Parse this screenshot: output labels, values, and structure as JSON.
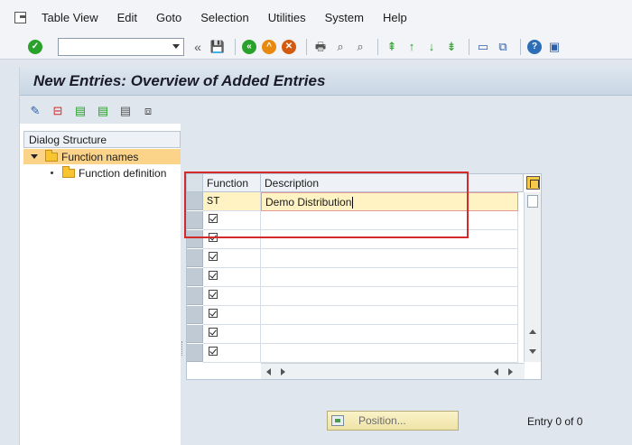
{
  "menu": {
    "items": [
      "Table View",
      "Edit",
      "Goto",
      "Selection",
      "Utilities",
      "System",
      "Help"
    ]
  },
  "toolbar": {
    "command_value": "",
    "icons": [
      "enter-checkmark-icon",
      "save-icon",
      "back-icon",
      "exit-icon",
      "cancel-icon",
      "print-icon",
      "find-icon",
      "find-next-icon",
      "first-page-icon",
      "previous-page-icon",
      "next-page-icon",
      "last-page-icon",
      "create-session-icon",
      "shortcut-icon",
      "help-icon",
      "customize-layout-icon"
    ]
  },
  "title": "New Entries: Overview of Added Entries",
  "dialog_structure": {
    "header": "Dialog Structure",
    "items": [
      {
        "label": "Function names",
        "level": 0,
        "selected": true
      },
      {
        "label": "Function definition",
        "level": 1,
        "selected": false
      }
    ]
  },
  "table": {
    "columns": [
      "Function",
      "Description"
    ],
    "rows": [
      {
        "function": "ST",
        "description": "Demo Distribution",
        "active": true
      },
      {
        "function": "",
        "description": "",
        "active": false
      },
      {
        "function": "",
        "description": "",
        "active": false
      },
      {
        "function": "",
        "description": "",
        "active": false
      },
      {
        "function": "",
        "description": "",
        "active": false
      },
      {
        "function": "",
        "description": "",
        "active": false
      },
      {
        "function": "",
        "description": "",
        "active": false
      },
      {
        "function": "",
        "description": "",
        "active": false
      },
      {
        "function": "",
        "description": "",
        "active": false
      }
    ]
  },
  "footer": {
    "position_button": "Position...",
    "entry_text": "Entry 0 of 0"
  },
  "colors": {
    "highlight_row": "#fff3c4",
    "selected_tree_item": "#fbd48a",
    "red_box": "#d42a2a"
  }
}
